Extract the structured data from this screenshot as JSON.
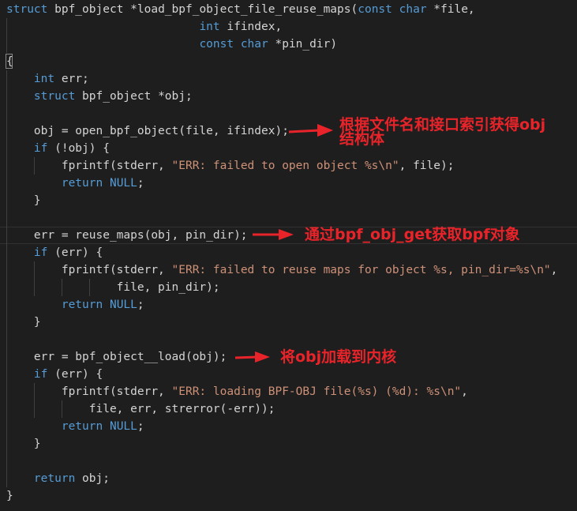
{
  "colors": {
    "background": "#1e1e1e",
    "keyword": "#569cd6",
    "string": "#ce9178",
    "text": "#d4d4d4",
    "annotation": "#e8242a"
  },
  "code": [
    [
      [
        "kw",
        "struct"
      ],
      [
        "txt",
        " bpf_object *load_bpf_object_file_reuse_maps("
      ],
      [
        "kw",
        "const"
      ],
      [
        "txt",
        " "
      ],
      [
        "kw",
        "char"
      ],
      [
        "txt",
        " *file,"
      ]
    ],
    [
      [
        "txt",
        "                            "
      ],
      [
        "kw",
        "int"
      ],
      [
        "txt",
        " ifindex,"
      ]
    ],
    [
      [
        "txt",
        "                            "
      ],
      [
        "kw",
        "const"
      ],
      [
        "txt",
        " "
      ],
      [
        "kw",
        "char"
      ],
      [
        "txt",
        " *pin_dir)"
      ]
    ],
    [
      [
        "txt",
        "{"
      ]
    ],
    [
      [
        "txt",
        "    "
      ],
      [
        "kw",
        "int"
      ],
      [
        "txt",
        " err;"
      ]
    ],
    [
      [
        "txt",
        "    "
      ],
      [
        "kw",
        "struct"
      ],
      [
        "txt",
        " bpf_object *obj;"
      ]
    ],
    [],
    [
      [
        "txt",
        "    obj = open_bpf_object(file, ifindex);"
      ]
    ],
    [
      [
        "txt",
        "    "
      ],
      [
        "kw",
        "if"
      ],
      [
        "txt",
        " (!obj) {"
      ]
    ],
    [
      [
        "txt",
        "        fprintf(stderr, "
      ],
      [
        "str",
        "\"ERR: failed to open object %s\\n\""
      ],
      [
        "txt",
        ", file);"
      ]
    ],
    [
      [
        "txt",
        "        "
      ],
      [
        "kw",
        "return"
      ],
      [
        "txt",
        " "
      ],
      [
        "kw",
        "NULL"
      ],
      [
        "txt",
        ";"
      ]
    ],
    [
      [
        "txt",
        "    }"
      ]
    ],
    [],
    [
      [
        "txt",
        "    err = reuse_maps(obj, pin_dir);"
      ]
    ],
    [
      [
        "txt",
        "    "
      ],
      [
        "kw",
        "if"
      ],
      [
        "txt",
        " (err) {"
      ]
    ],
    [
      [
        "txt",
        "        fprintf(stderr, "
      ],
      [
        "str",
        "\"ERR: failed to reuse maps for object %s, pin_dir=%s\\n\""
      ],
      [
        "txt",
        ","
      ]
    ],
    [
      [
        "txt",
        "                file, pin_dir);"
      ]
    ],
    [
      [
        "txt",
        "        "
      ],
      [
        "kw",
        "return"
      ],
      [
        "txt",
        " "
      ],
      [
        "kw",
        "NULL"
      ],
      [
        "txt",
        ";"
      ]
    ],
    [
      [
        "txt",
        "    }"
      ]
    ],
    [],
    [
      [
        "txt",
        "    err = bpf_object__load(obj);"
      ]
    ],
    [
      [
        "txt",
        "    "
      ],
      [
        "kw",
        "if"
      ],
      [
        "txt",
        " (err) {"
      ]
    ],
    [
      [
        "txt",
        "        fprintf(stderr, "
      ],
      [
        "str",
        "\"ERR: loading BPF-OBJ file(%s) (%d): %s\\n\""
      ],
      [
        "txt",
        ","
      ]
    ],
    [
      [
        "txt",
        "            file, err, strerror(-err));"
      ]
    ],
    [
      [
        "txt",
        "        "
      ],
      [
        "kw",
        "return"
      ],
      [
        "txt",
        " "
      ],
      [
        "kw",
        "NULL"
      ],
      [
        "txt",
        ";"
      ]
    ],
    [
      [
        "txt",
        "    }"
      ]
    ],
    [],
    [
      [
        "txt",
        "    "
      ],
      [
        "kw",
        "return"
      ],
      [
        "txt",
        " obj;"
      ]
    ],
    [
      [
        "txt",
        "}"
      ]
    ]
  ],
  "current_line": 14,
  "annotations": [
    {
      "line1": "根据文件名和接口索引获得obj",
      "line2": "结构体"
    },
    {
      "line1": "通过bpf_obj_get获取bpf对象"
    },
    {
      "line1": "将obj加载到内核"
    }
  ]
}
